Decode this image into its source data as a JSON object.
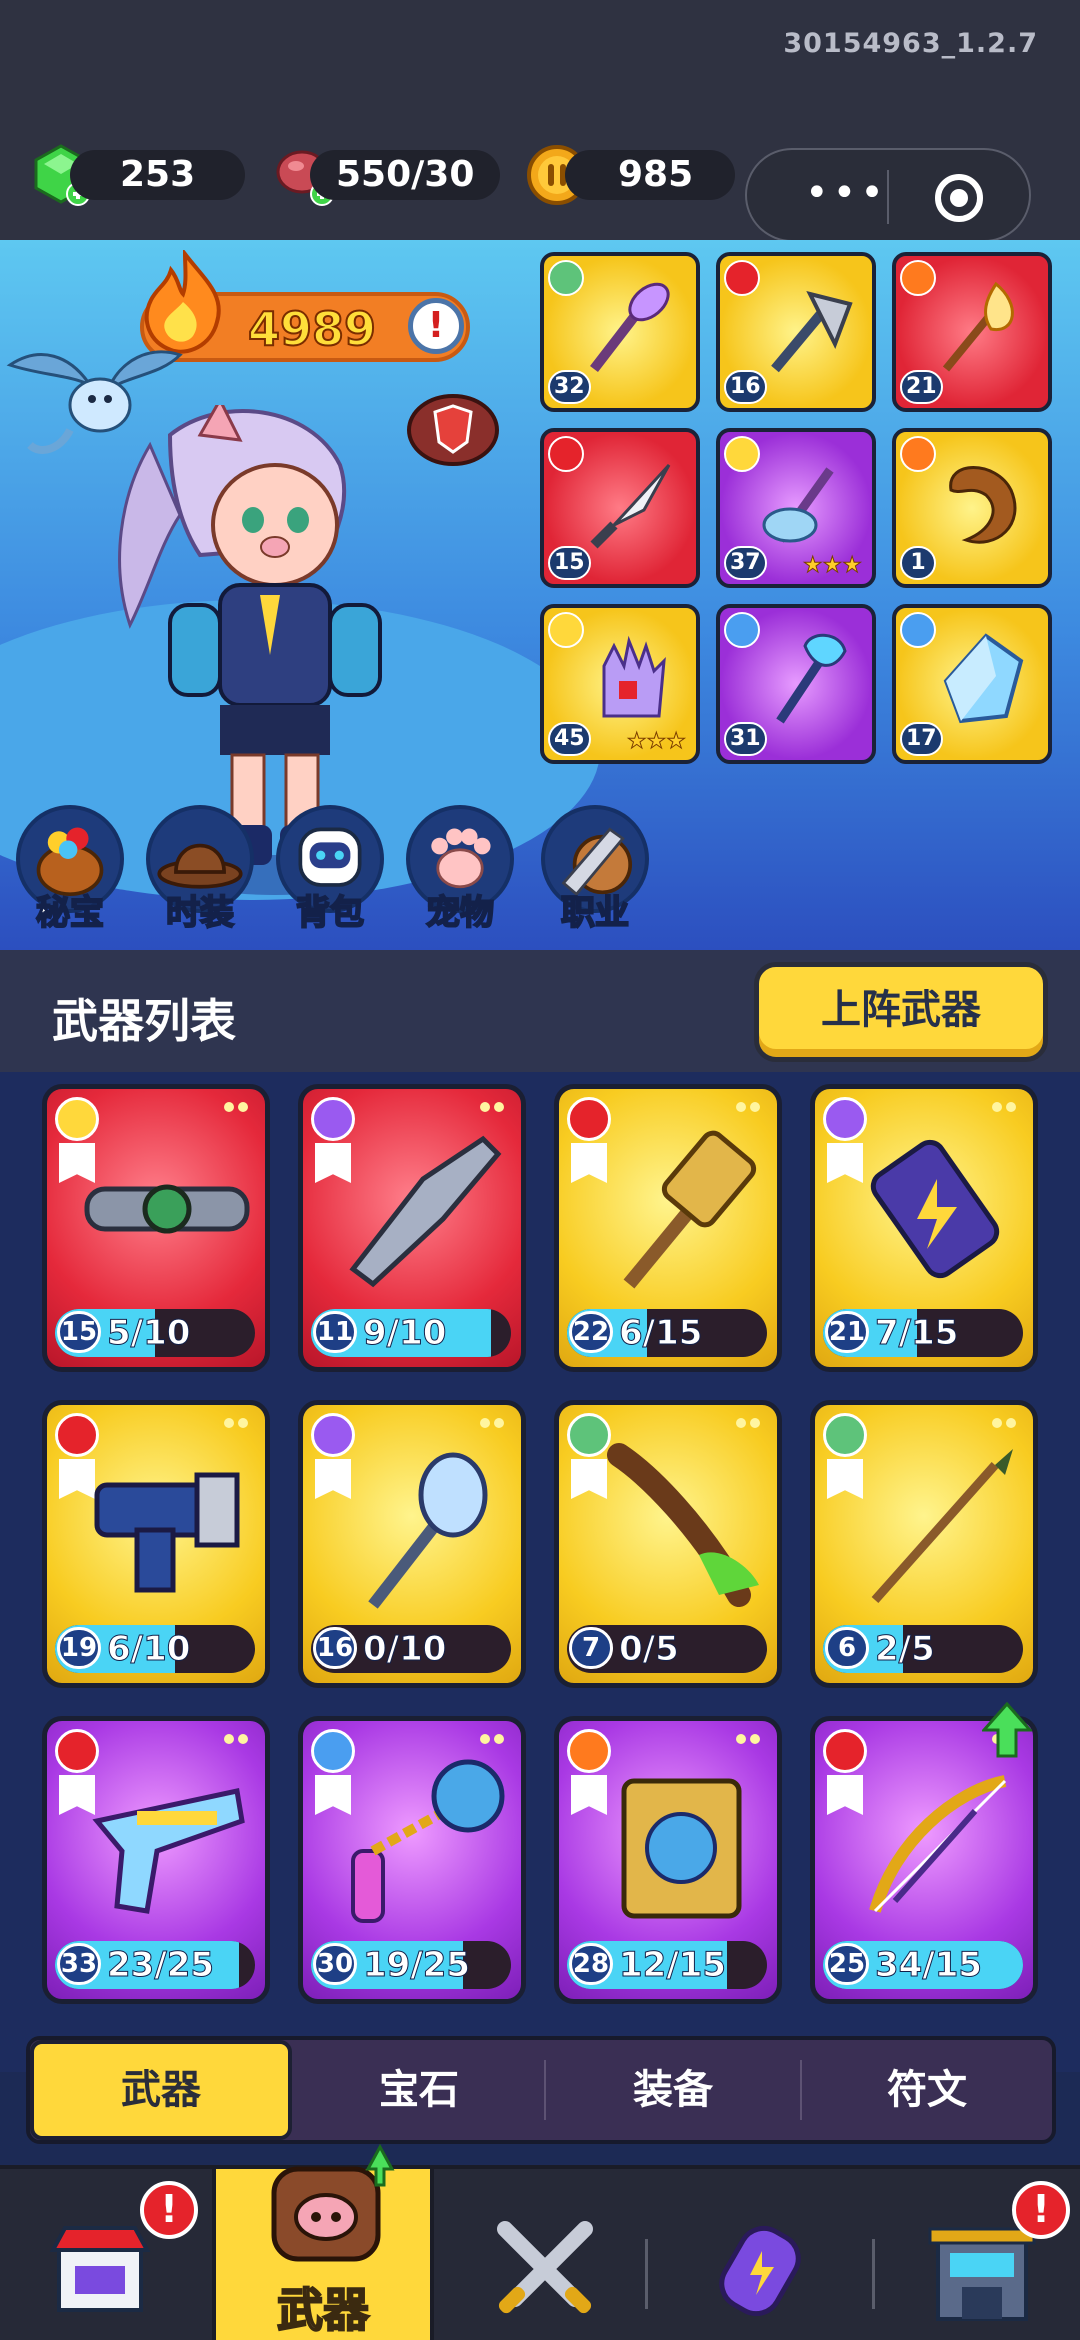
{
  "version": "30154963_1.2.7",
  "resources": {
    "gems": "253",
    "meat": "550/30",
    "coins": "985"
  },
  "capsule": {
    "more": "•••"
  },
  "hero": {
    "power": "4989",
    "power_alert": "!"
  },
  "equipped": [
    {
      "level": "32",
      "color": "yellow",
      "icon": "feather-staff-icon"
    },
    {
      "level": "16",
      "color": "yellow",
      "icon": "axe-icon"
    },
    {
      "level": "21",
      "color": "red",
      "icon": "flame-spear-icon"
    },
    {
      "level": "15",
      "color": "red",
      "icon": "dagger-icon"
    },
    {
      "level": "37",
      "color": "purple",
      "icon": "crystal-hammer-icon",
      "stars": "★★★"
    },
    {
      "level": "1",
      "color": "yellow",
      "icon": "horn-icon"
    },
    {
      "level": "45",
      "color": "yellow",
      "icon": "glove-icon",
      "stars": "★★★"
    },
    {
      "level": "31",
      "color": "purple",
      "icon": "trident-staff-icon"
    },
    {
      "level": "17",
      "color": "yellow",
      "icon": "ice-crystal-icon"
    }
  ],
  "hub": [
    "秘宝",
    "时装",
    "背包",
    "宠物",
    "职业"
  ],
  "list": {
    "title": "武器列表",
    "deploy_label": "上阵武器"
  },
  "weapons": [
    {
      "level": "15",
      "count": "5/10",
      "progress": 0.5,
      "color": "red",
      "icon": "belt-icon"
    },
    {
      "level": "11",
      "count": "9/10",
      "progress": 0.9,
      "color": "red",
      "icon": "boomerang-icon"
    },
    {
      "level": "22",
      "count": "6/15",
      "progress": 0.4,
      "color": "yellow",
      "icon": "hammer-icon"
    },
    {
      "level": "21",
      "count": "7/15",
      "progress": 0.47,
      "color": "yellow",
      "icon": "battery-icon"
    },
    {
      "level": "19",
      "count": "6/10",
      "progress": 0.6,
      "color": "yellow",
      "icon": "blaster-icon"
    },
    {
      "level": "16",
      "count": "0/10",
      "progress": 0,
      "color": "yellow",
      "icon": "mace-icon"
    },
    {
      "level": "7",
      "count": "0/5",
      "progress": 0,
      "color": "yellow",
      "icon": "slime-club-icon"
    },
    {
      "level": "6",
      "count": "2/5",
      "progress": 0.4,
      "color": "yellow",
      "icon": "spear-icon"
    },
    {
      "level": "33",
      "count": "23/25",
      "progress": 0.92,
      "color": "purple",
      "icon": "space-gun-icon"
    },
    {
      "level": "30",
      "count": "19/25",
      "progress": 0.76,
      "color": "purple",
      "icon": "chain-flail-icon"
    },
    {
      "level": "28",
      "count": "12/15",
      "progress": 0.8,
      "color": "purple",
      "icon": "spellbook-icon"
    },
    {
      "level": "25",
      "count": "34/15",
      "progress": 1.0,
      "color": "purple",
      "icon": "bow-icon"
    }
  ],
  "tabs": [
    "武器",
    "宝石",
    "装备",
    "符文"
  ],
  "nav": {
    "active_label": "武器",
    "alert": "!"
  },
  "colors": {
    "accent": "#ffd83b",
    "red_card": "#e5293b",
    "yellow_card": "#f8cc21",
    "purple_card": "#a939e4",
    "progress": "#4ad4f5"
  }
}
